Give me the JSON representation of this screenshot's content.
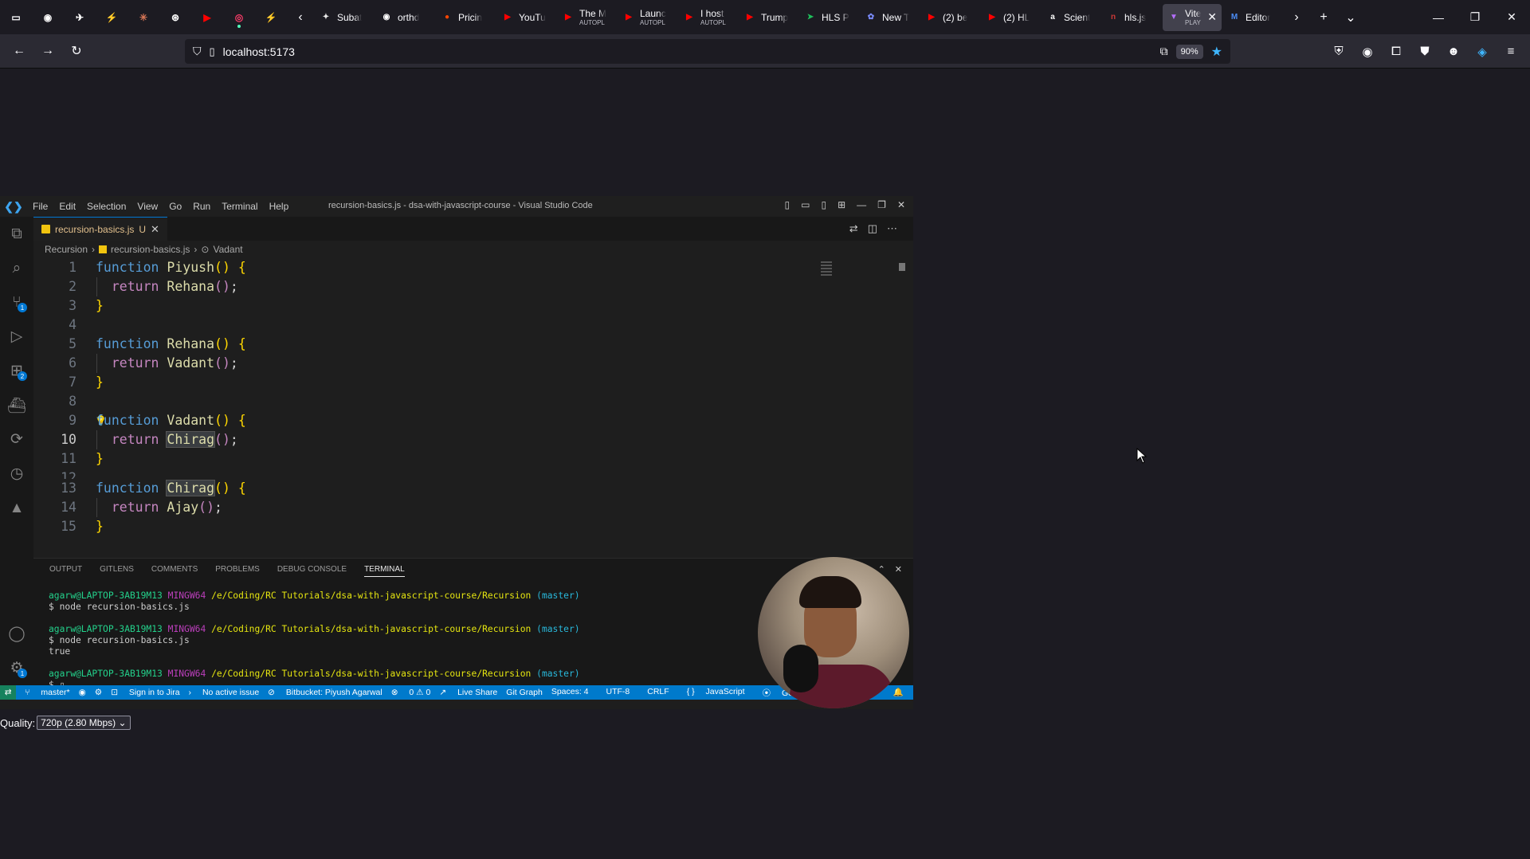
{
  "browser": {
    "pinned_tabs": [
      {
        "icon": "tab-list-icon",
        "color": "#fbfbfe"
      },
      {
        "icon": "github-icon",
        "color": "#ffffff"
      },
      {
        "icon": "postman-icon",
        "color": "#ffffff"
      },
      {
        "icon": "lightning-icon",
        "color": "#f5a623"
      },
      {
        "icon": "claude-icon",
        "color": "#d97757"
      },
      {
        "icon": "chatgpt-icon",
        "color": "#ffffff"
      },
      {
        "icon": "youtube-icon",
        "color": "#ff0000"
      },
      {
        "icon": "recorder-icon",
        "color": "#ff3d6a"
      },
      {
        "icon": "bolt-icon",
        "color": "#f5a623"
      }
    ],
    "tabs": [
      {
        "label": "Subat",
        "sub": "",
        "icon": "brand-icon",
        "color": "#e8e8e8"
      },
      {
        "label": "orthd",
        "sub": "",
        "icon": "github-icon",
        "color": "#ffffff"
      },
      {
        "label": "Pricin",
        "sub": "",
        "icon": "reddit-icon",
        "color": "#ff4500"
      },
      {
        "label": "YouTu",
        "sub": "",
        "icon": "youtube-icon",
        "color": "#ff0000"
      },
      {
        "label": "The M",
        "sub": "AUTOPL",
        "icon": "youtube-icon",
        "color": "#ff0000"
      },
      {
        "label": "Launc",
        "sub": "AUTOPL",
        "icon": "youtube-icon",
        "color": "#ff0000"
      },
      {
        "label": "I host",
        "sub": "AUTOPL",
        "icon": "youtube-icon",
        "color": "#ff0000"
      },
      {
        "label": "Trump",
        "sub": "",
        "icon": "youtube-icon",
        "color": "#ff0000"
      },
      {
        "label": "HLS P",
        "sub": "",
        "icon": "hls-icon",
        "color": "#1fbf5b"
      },
      {
        "label": "New T",
        "sub": "",
        "icon": "firefox-icon",
        "color": "#7b8cff"
      },
      {
        "label": "(2) be",
        "sub": "",
        "icon": "youtube-icon",
        "color": "#ff0000"
      },
      {
        "label": "(2) HL",
        "sub": "",
        "icon": "youtube-icon",
        "color": "#ff0000"
      },
      {
        "label": "Scient",
        "sub": "",
        "icon": "amazon-icon",
        "color": "#ffffff"
      },
      {
        "label": "hls.js",
        "sub": "",
        "icon": "npm-icon",
        "color": "#cb3837"
      },
      {
        "label": "Vite",
        "sub": "PLAY",
        "icon": "vite-icon",
        "color": "#b56eff",
        "active": true
      },
      {
        "label": "Editor",
        "sub": "",
        "icon": "m-icon",
        "color": "#4b8cf5"
      }
    ],
    "url": "localhost:5173",
    "zoom": "90%"
  },
  "vscode": {
    "menu": [
      "File",
      "Edit",
      "Selection",
      "View",
      "Go",
      "Run",
      "Terminal",
      "Help"
    ],
    "window_title": "recursion-basics.js - dsa-with-javascript-course - Visual Studio Code",
    "tab_label": "recursion-basics.js",
    "tab_modified": "U",
    "breadcrumb": [
      "Recursion",
      "recursion-basics.js",
      "Vadant"
    ],
    "source_control_badge": "1",
    "extensions_badge": "2",
    "settings_badge": "1",
    "panel_tabs": [
      "OUTPUT",
      "GITLENS",
      "COMMENTS",
      "PROBLEMS",
      "DEBUG CONSOLE",
      "TERMINAL"
    ],
    "panel_shell": "bash",
    "terminal": {
      "user": "agarw@LAPTOP-3AB19M13",
      "env": "MINGW64",
      "path": "/e/Coding/RC Tutorials/dsa-with-javascript-course/Recursion",
      "branch": "(master)",
      "cmd1": "$ node recursion-basics.js",
      "cmd2": "$ node recursion-basics.js",
      "out2": "true",
      "prompt": "$ "
    },
    "status": {
      "branch": "master*",
      "jira": "Sign in to Jira",
      "issue": "No active issue",
      "bitbucket": "Bitbucket: Piyush Agarwal",
      "problems": "0 ⚠ 0",
      "liveshare": "Live Share",
      "gitgraph": "Git Graph",
      "spaces": "Spaces: 4",
      "encoding": "UTF-8",
      "eol": "CRLF",
      "language": "JavaScript",
      "golive": "Go Live"
    }
  },
  "quality": {
    "label": "Quality:",
    "value": "720p (2.80 Mbps)"
  }
}
